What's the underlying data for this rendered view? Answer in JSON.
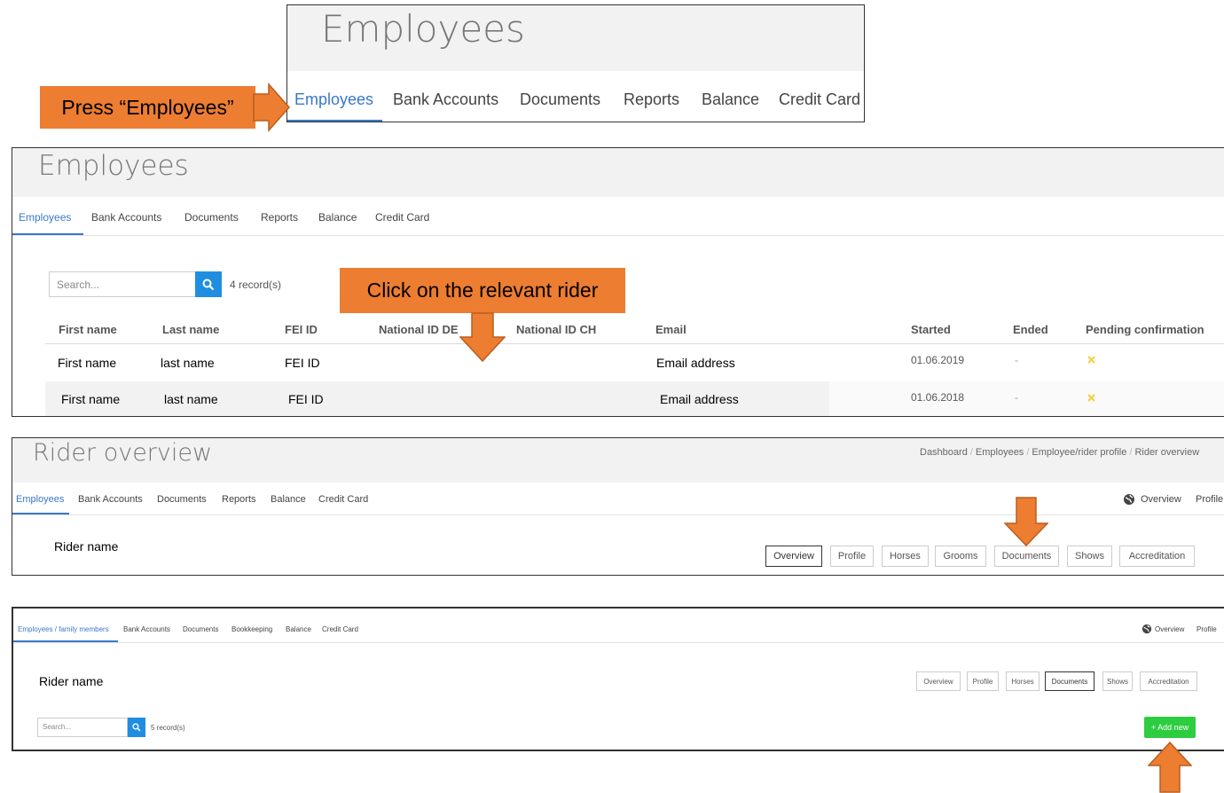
{
  "panel1": {
    "title": "Employees",
    "tabs": [
      "Employees",
      "Bank Accounts",
      "Documents",
      "Reports",
      "Balance",
      "Credit Card"
    ],
    "callout": "Press “Employees”"
  },
  "panel2": {
    "title": "Employees",
    "tabs": [
      "Employees",
      "Bank Accounts",
      "Documents",
      "Reports",
      "Balance",
      "Credit Card"
    ],
    "search": {
      "placeholder": "Search...",
      "records": "4 record(s)"
    },
    "callout": "Click on the relevant rider",
    "columns": [
      "First name",
      "Last name",
      "FEI ID",
      "National ID DE",
      "National ID CH",
      "Email",
      "Started",
      "Ended",
      "Pending confirmation"
    ],
    "rows": [
      {
        "first": "First name",
        "last": "last name",
        "fei": "FEI ID",
        "email": "Email address",
        "started": "01.06.2019",
        "ended": "-"
      },
      {
        "first": "First name",
        "last": "last name",
        "fei": "FEI ID",
        "email": "Email address",
        "started": "01.06.2018",
        "ended": "-"
      }
    ],
    "pending_icon": "cross-icon",
    "pending_color": "#f4d03f"
  },
  "panel3": {
    "title": "Rider overview",
    "breadcrumb": [
      "Dashboard",
      "Employees",
      "Employee/rider profile",
      "Rider overview"
    ],
    "tabs": [
      "Employees",
      "Bank Accounts",
      "Documents",
      "Reports",
      "Balance",
      "Credit Card"
    ],
    "right_links": [
      "Overview",
      "Profile"
    ],
    "rider_name": "Rider name",
    "buttons": [
      "Overview",
      "Profile",
      "Horses",
      "Grooms",
      "Documents",
      "Shows",
      "Accreditation"
    ]
  },
  "panel4": {
    "tabs": [
      "Employees / family members",
      "Bank Accounts",
      "Documents",
      "Bookkeeping",
      "Balance",
      "Credit Card"
    ],
    "right_links": [
      "Overview",
      "Profile"
    ],
    "rider_name": "Rider name",
    "buttons": [
      "Overview",
      "Profile",
      "Horses",
      "Documents",
      "Shows",
      "Accreditation"
    ],
    "search": {
      "placeholder": "Search...",
      "records": "5 record(s)"
    },
    "add_button": "+ Add new",
    "add_color": "#2ecc40"
  },
  "colors": {
    "accent": "#3a78c9",
    "callout": "#ed7d31",
    "search_button": "#1f8ee0"
  }
}
